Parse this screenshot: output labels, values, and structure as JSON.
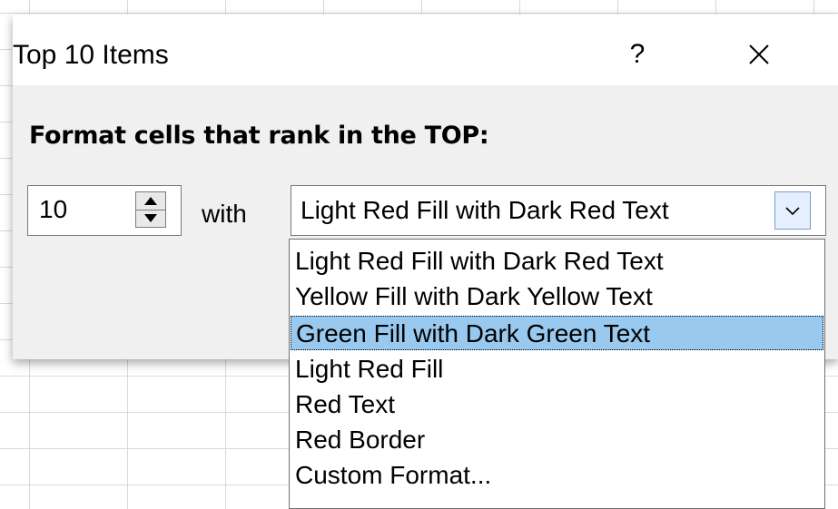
{
  "dialog": {
    "title": "Top 10 Items",
    "help_label": "?",
    "close_icon": "close-icon",
    "prompt": "Format cells that rank in the TOP:",
    "rank_value": "10",
    "with_label": "with",
    "format_selected": "Light Red Fill with Dark Red Text",
    "format_options": [
      "Light Red Fill with Dark Red Text",
      "Yellow Fill with Dark Yellow Text",
      "Green Fill with Dark Green Text",
      "Light Red Fill",
      "Red Text",
      "Red Border",
      "Custom Format..."
    ],
    "highlighted_option_index": 2
  },
  "colors": {
    "highlight": "#99c9ef",
    "dialog_bg": "#f0f0f0",
    "grid_line": "#d9d9d9"
  }
}
